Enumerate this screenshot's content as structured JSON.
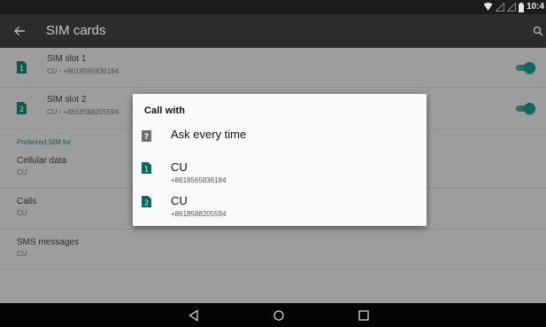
{
  "status_bar": {
    "time": "10:4"
  },
  "app_bar": {
    "title": "SIM cards"
  },
  "sim_slots": [
    {
      "title": "SIM slot 1",
      "subtitle": "CU - +8618565836184",
      "slot_number": "1",
      "enabled": true
    },
    {
      "title": "SIM slot 2",
      "subtitle": "CU - +8618588205594",
      "slot_number": "2",
      "enabled": true
    }
  ],
  "preferred": {
    "header": "Preferred SIM for",
    "items": [
      {
        "title": "Cellular data",
        "value": "CU"
      },
      {
        "title": "Calls",
        "value": "CU"
      },
      {
        "title": "SMS messages",
        "value": "CU"
      }
    ]
  },
  "dialog": {
    "title": "Call with",
    "options": [
      {
        "label": "Ask every time",
        "icon": "question-icon"
      },
      {
        "label": "CU",
        "number": "+8618565836184",
        "slot_number": "1"
      },
      {
        "label": "CU",
        "number": "+8618588205594",
        "slot_number": "2"
      }
    ]
  },
  "colors": {
    "accent": "#0b6a5a",
    "toolbar": "#2c2c2c",
    "status": "#1c1c1c",
    "dialog": "#fafafa",
    "scrim": "#9d9d9d"
  },
  "nav": {
    "icons": [
      "back-icon",
      "home-icon",
      "recents-icon"
    ]
  }
}
